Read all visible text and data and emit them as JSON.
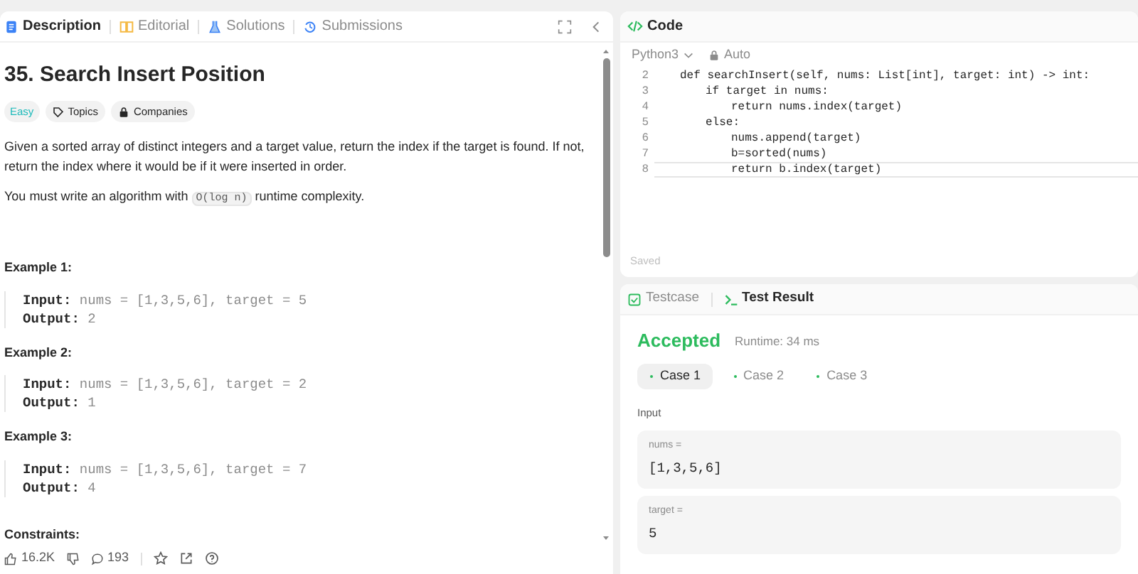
{
  "description_panel": {
    "tabs": [
      {
        "label": "Description",
        "selected": true
      },
      {
        "label": "Editorial",
        "selected": false
      },
      {
        "label": "Solutions",
        "selected": false
      },
      {
        "label": "Submissions",
        "selected": false
      }
    ],
    "title": "35. Search Insert Position",
    "tags": [
      {
        "label": "Easy",
        "kind": "difficulty"
      },
      {
        "label": "Topics",
        "kind": "topics"
      },
      {
        "label": "Companies",
        "kind": "companies"
      }
    ],
    "paragraphs": [
      {
        "parts": [
          {
            "text": "Given a sorted array of distinct integers and a target value, return the index if the target is found. If not, return the index where it would be if it were inserted in order.",
            "kind": "text"
          }
        ]
      },
      {
        "parts": [
          {
            "text": "You must write an algorithm with",
            "kind": "text"
          },
          {
            "text": "O(log n)",
            "kind": "code"
          },
          {
            "text": "runtime complexity.",
            "kind": "text"
          }
        ]
      }
    ],
    "examples": [
      {
        "heading": "Example 1:",
        "input_label": "Input:",
        "input": "nums = [1,3,5,6], target = 5",
        "output_label": "Output:",
        "output": "2"
      },
      {
        "heading": "Example 2:",
        "input_label": "Input:",
        "input": "nums = [1,3,5,6], target = 2",
        "output_label": "Output:",
        "output": "1"
      },
      {
        "heading": "Example 3:",
        "input_label": "Input:",
        "input": "nums = [1,3,5,6], target = 7",
        "output_label": "Output:",
        "output": "4"
      }
    ],
    "constraints_heading": "Constraints:",
    "footer": {
      "likes": "16.2K",
      "comments": "193"
    }
  },
  "code_panel": {
    "title": "Code",
    "language": "Python3",
    "mode": "Auto",
    "lines": [
      {
        "number": "2",
        "text": "def searchInsert(self, nums: List[int], target: int) -> int:",
        "active": false,
        "children": [
          {
            "number": "3",
            "text": "if target in nums:",
            "active": false,
            "children": [
              {
                "number": "4",
                "text": "return nums.index(target)",
                "active": false
              }
            ]
          },
          {
            "number": "5",
            "text": "else:",
            "active": false,
            "children": [
              {
                "number": "6",
                "text": "nums.append(target)",
                "active": false
              },
              {
                "number": "7",
                "text": "b=sorted(nums)",
                "active": false
              },
              {
                "number": "8",
                "text": "return b.index(target)",
                "active": true
              }
            ]
          }
        ]
      }
    ],
    "status": "Saved"
  },
  "result_panel": {
    "tabs": [
      {
        "label": "Testcase",
        "selected": false
      },
      {
        "label": "Test Result",
        "selected": true
      }
    ],
    "verdict": "Accepted",
    "runtime": "Runtime: 34 ms",
    "cases": [
      {
        "label": "Case 1",
        "selected": true
      },
      {
        "label": "Case 2",
        "selected": false
      },
      {
        "label": "Case 3",
        "selected": false
      }
    ],
    "input_heading": "Input",
    "inputs": [
      {
        "name": "nums =",
        "value": "[1,3,5,6]"
      },
      {
        "name": "target =",
        "value": "5"
      }
    ]
  }
}
